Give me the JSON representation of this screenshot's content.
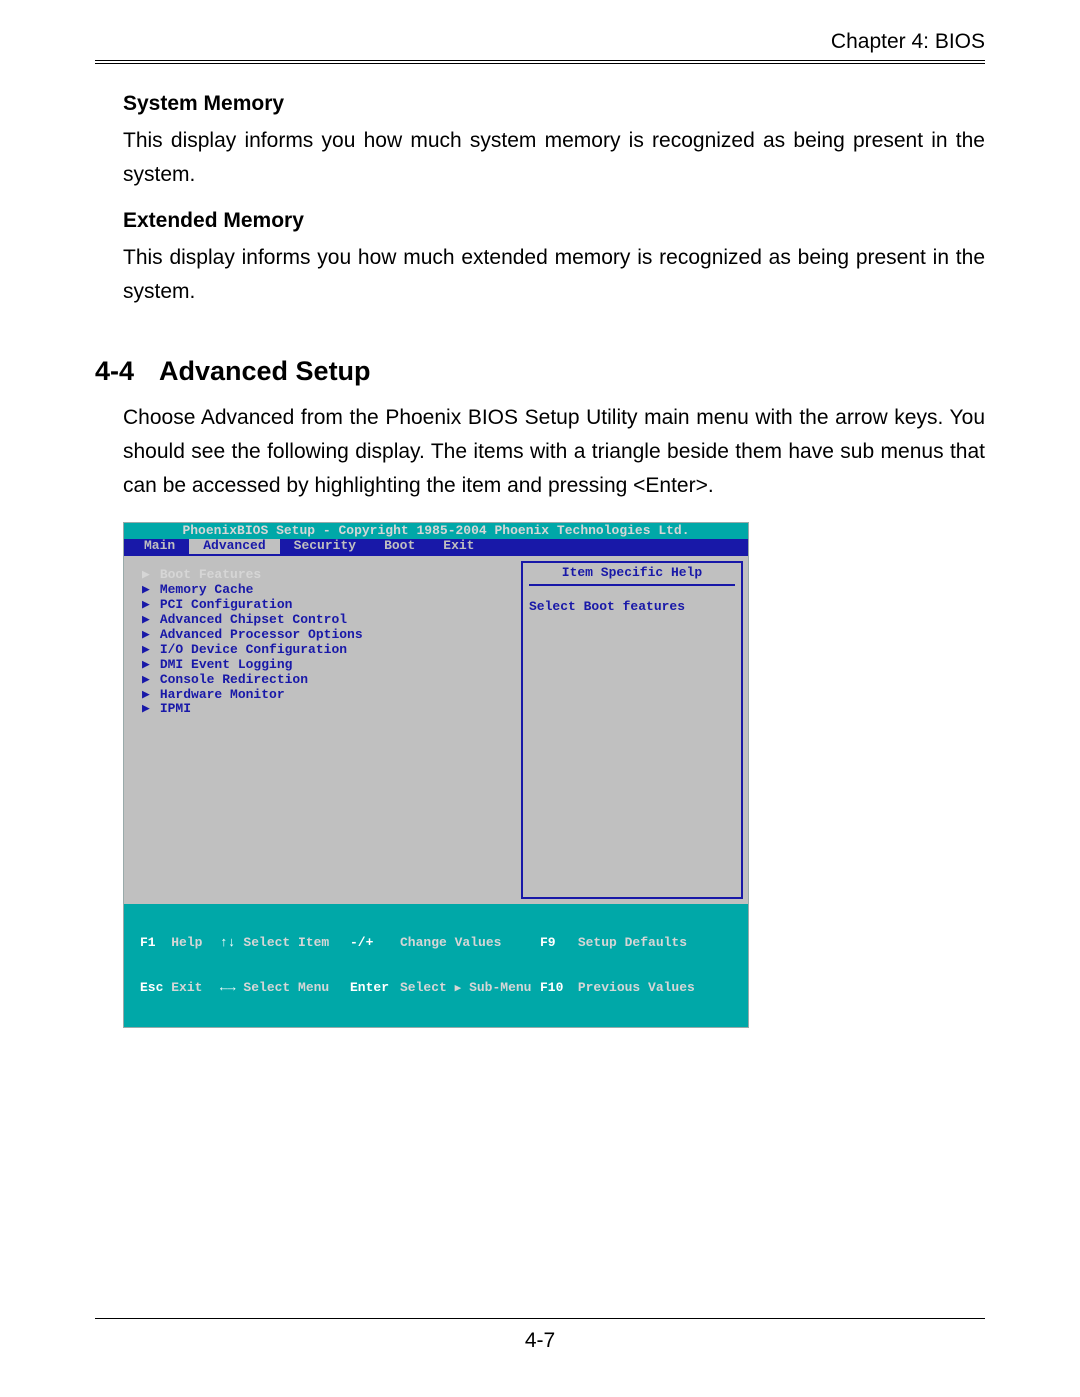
{
  "chapter_header": "Chapter 4: BIOS",
  "sections": {
    "system_memory": {
      "heading": "System Memory",
      "body": "This display informs you how much system memory is recognized as being present in the system."
    },
    "extended_memory": {
      "heading": "Extended Memory",
      "body": "This display informs you how much extended memory is recognized as being present in the system."
    },
    "advanced_setup": {
      "number": "4-4",
      "title": "Advanced Setup",
      "body": "Choose Advanced from the Phoenix BIOS Setup Utility main menu with the arrow keys. You should see the following display.  The items with a triangle beside them have sub menus that can be accessed by highlighting the item and pressing <Enter>."
    }
  },
  "bios": {
    "title": "PhoenixBIOS Setup - Copyright 1985-2004 Phoenix Technologies Ltd.",
    "tabs": [
      "Main",
      "Advanced",
      "Security",
      "Boot",
      "Exit"
    ],
    "active_tab": "Advanced",
    "menu_items": [
      "Boot Features",
      "Memory Cache",
      "PCI Configuration",
      "Advanced Chipset Control",
      "Advanced Processor Options",
      "I/O Device Configuration",
      "DMI Event Logging",
      "Console Redirection",
      "Hardware Monitor",
      "IPMI"
    ],
    "selected_item": "Boot Features",
    "help_title": "Item Specific Help",
    "help_text": "Select Boot features",
    "footer": {
      "row1": {
        "k1": "F1",
        "a1": "Help",
        "k2": "↑↓",
        "a2": "Select Item",
        "k3": "-/+",
        "a3": "Change Values",
        "k4": "F9",
        "a4": "Setup Defaults"
      },
      "row2": {
        "k1": "Esc",
        "a1": "Exit",
        "k2": "←→",
        "a2": "Select Menu",
        "k3": "Enter",
        "a3_a": "Select",
        "a3_b": "Sub-Menu",
        "k4": "F10",
        "a4": "Previous Values"
      }
    }
  },
  "page_number": "4-7"
}
